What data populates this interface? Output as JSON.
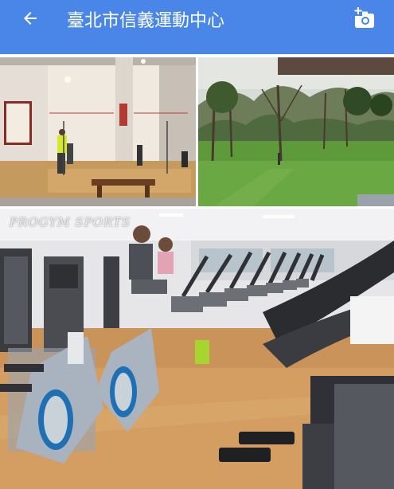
{
  "header": {
    "title": "臺北市信義運動中心",
    "back_icon": "arrow-back-icon",
    "add_photo_icon": "add-photo-icon",
    "bg_color": "#4a86e8"
  },
  "photos": [
    {
      "subject": "squash court",
      "name": "photo-squash"
    },
    {
      "subject": "park lawn with trees",
      "name": "photo-park"
    },
    {
      "subject": "gym with cardio machines",
      "name": "photo-gym"
    }
  ],
  "watermark": "PROGYM SPORTS"
}
